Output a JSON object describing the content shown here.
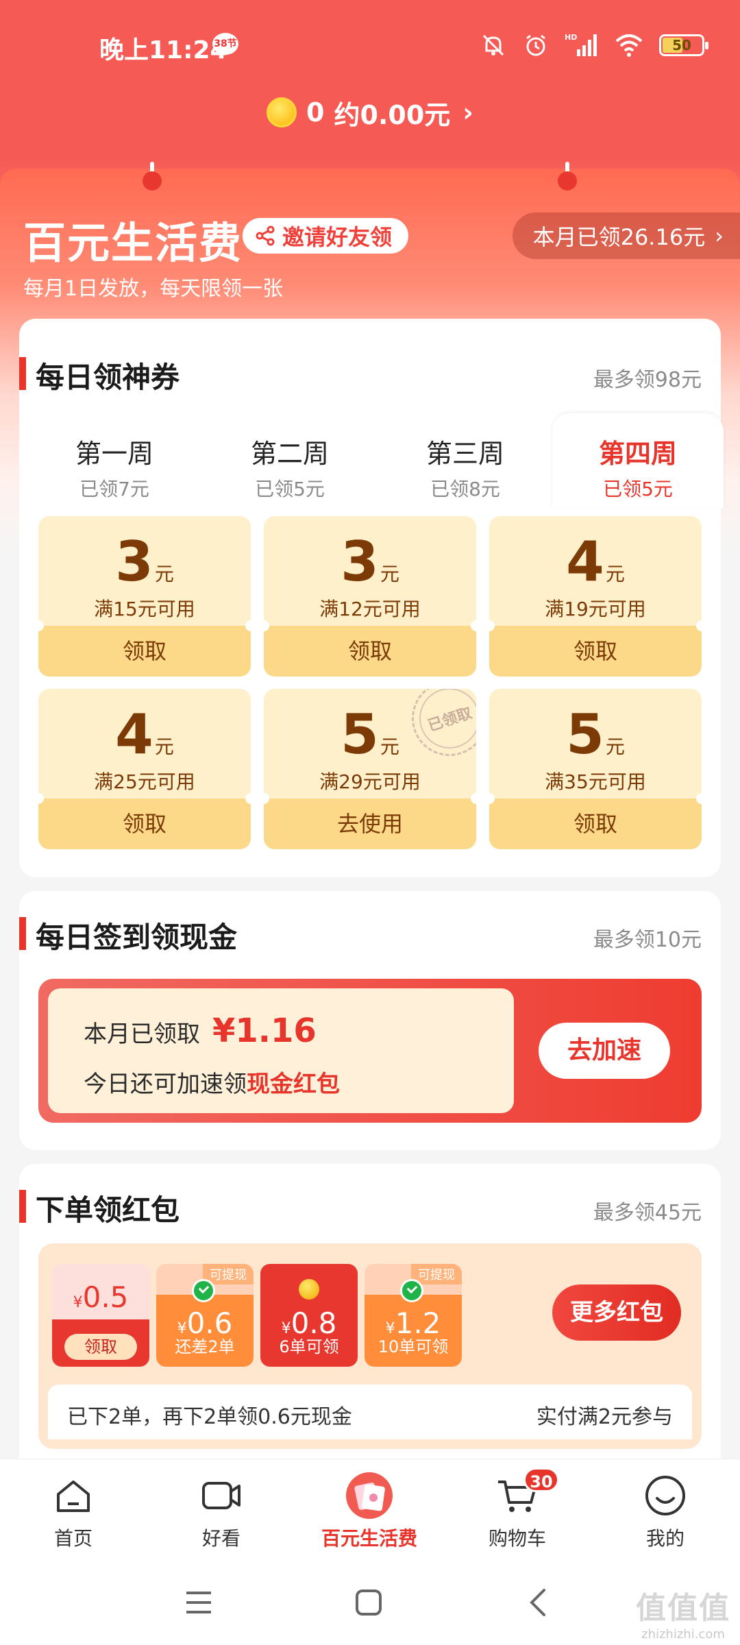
{
  "status_bar": {
    "time": "晚上11:24",
    "badge": "38节",
    "battery": "50"
  },
  "coins": {
    "count": "0",
    "approx": "约0.00元",
    "chevron": "›"
  },
  "hero": {
    "title": "百元生活费",
    "invite_label": "邀请好友领",
    "subtitle": "每月1日发放，每天限领一张",
    "month_received": "本月已领26.16元",
    "chevron": "›"
  },
  "daily_coupons": {
    "title": "每日领神券",
    "max_label": "最多领98元",
    "weeks": [
      {
        "name": "第一周",
        "sub": "已领7元"
      },
      {
        "name": "第二周",
        "sub": "已领5元"
      },
      {
        "name": "第三周",
        "sub": "已领8元"
      },
      {
        "name": "第四周",
        "sub": "已领5元"
      }
    ],
    "active_week_index": 3,
    "unit": "元",
    "coupons": [
      {
        "amount": "3",
        "condition": "满15元可用",
        "button": "领取"
      },
      {
        "amount": "3",
        "condition": "满12元可用",
        "button": "领取"
      },
      {
        "amount": "4",
        "condition": "满19元可用",
        "button": "领取"
      },
      {
        "amount": "4",
        "condition": "满25元可用",
        "button": "领取"
      },
      {
        "amount": "5",
        "condition": "满29元可用",
        "button": "去使用",
        "stamp": "已领取"
      },
      {
        "amount": "5",
        "condition": "满35元可用",
        "button": "领取"
      }
    ]
  },
  "checkin": {
    "title": "每日签到领现金",
    "max_label": "最多领10元",
    "received_label": "本月已领取",
    "received_amount": "¥1.16",
    "line2_prefix": "今日还可加速领",
    "line2_highlight": "现金红包",
    "speed_button": "去加速"
  },
  "order_packets": {
    "title": "下单领红包",
    "max_label": "最多领45元",
    "packets": [
      {
        "value": "0.5",
        "label": "领取",
        "tag": ""
      },
      {
        "value": "0.6",
        "label": "还差2单",
        "tag": "可提现"
      },
      {
        "value": "0.8",
        "label": "6单可领",
        "tag": ""
      },
      {
        "value": "1.2",
        "label": "10单可领",
        "tag": "可提现"
      }
    ],
    "yen": "¥",
    "more_button": "更多红包",
    "info_left": "已下2单，再下2单领0.6元现金",
    "info_right": "实付满2元参与"
  },
  "bottom_nav": {
    "items": [
      {
        "label": "首页"
      },
      {
        "label": "好看"
      },
      {
        "label": "百元生活费"
      },
      {
        "label": "购物车"
      },
      {
        "label": "我的"
      }
    ],
    "cart_badge": "30"
  },
  "watermark": {
    "main": "值值值",
    "sub": "zhizhizhi.com"
  },
  "colors": {
    "brand_red": "#e8352c",
    "coupon_bg": "#fff0cc",
    "coupon_btn": "#fcd988"
  }
}
